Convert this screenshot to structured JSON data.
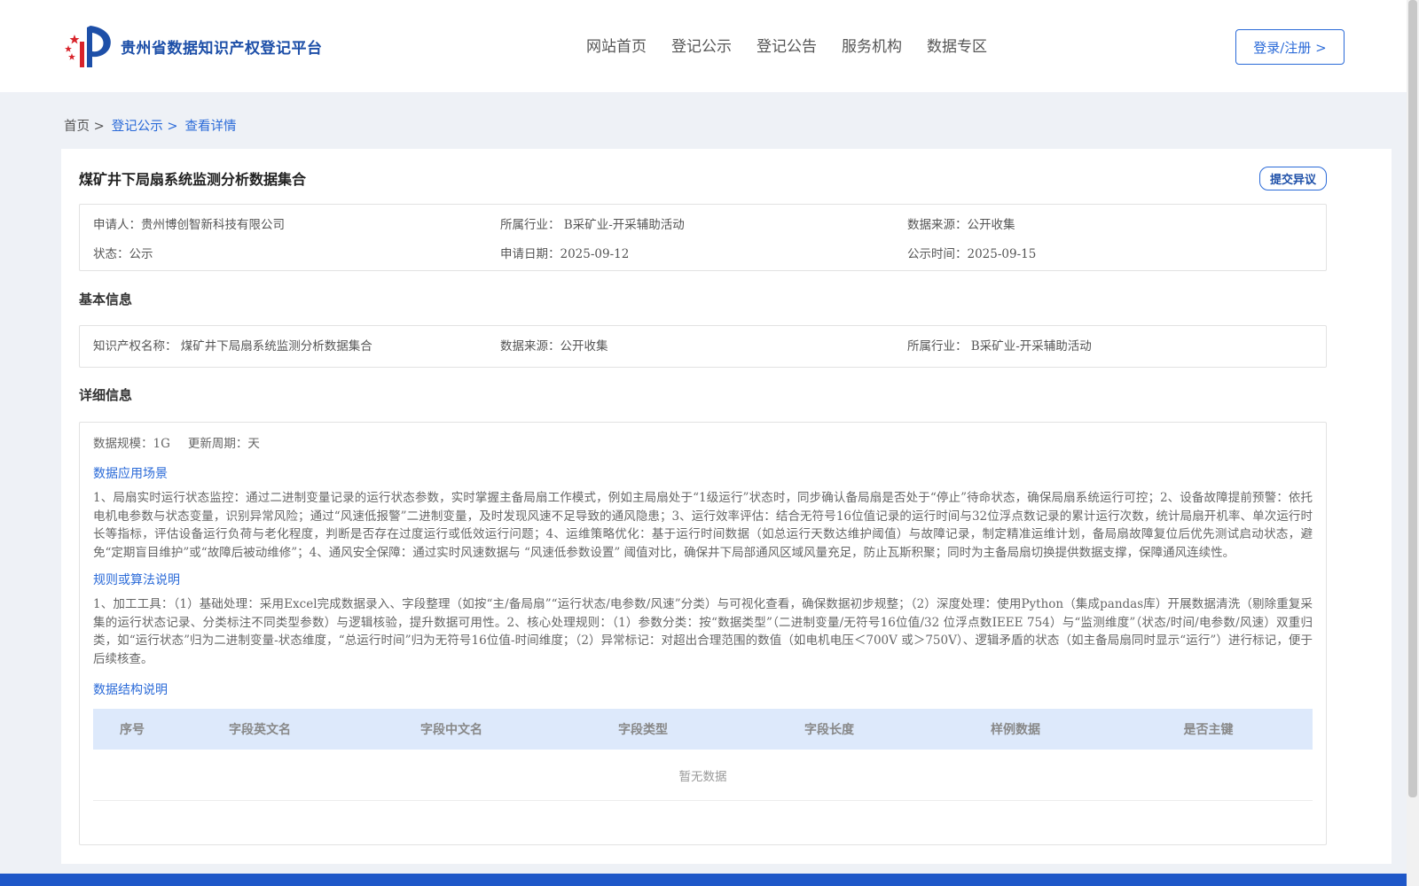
{
  "header": {
    "site_title": "贵州省数据知识产权登记平台",
    "nav": [
      "网站首页",
      "登记公示",
      "登记公告",
      "服务机构",
      "数据专区"
    ],
    "login_label": "登录/注册 >"
  },
  "breadcrumb": {
    "home": "首页 >",
    "list": "登记公示 >",
    "current": "查看详情"
  },
  "record": {
    "title": "煤矿井下局扇系统监测分析数据集合",
    "dispute_label": "提交异议",
    "summary": {
      "applicant": "申请人：贵州博创智新科技有限公司",
      "industry": "所属行业： B采矿业-开采辅助活动",
      "source": "数据来源：公开收集",
      "status": "状态：公示",
      "apply_date": "申请日期：2025-09-12",
      "public_date": "公示时间：2025-09-15"
    }
  },
  "basic": {
    "section_title": "基本信息",
    "ip_name": "知识产权名称： 煤矿井下局扇系统监测分析数据集合",
    "source": "数据来源：公开收集",
    "industry": "所属行业： B采矿业-开采辅助活动"
  },
  "detail": {
    "section_title": "详细信息",
    "scale": "数据规模：1G",
    "cycle": "更新周期：天",
    "scenario_title": "数据应用场景",
    "scenario_text": "1、局扇实时运行状态监控：通过二进制变量记录的运行状态参数，实时掌握主备局扇工作模式，例如主局扇处于“1级运行”状态时，同步确认备局扇是否处于“停止”待命状态，确保局扇系统运行可控；2、设备故障提前预警：依托电机电参数与状态变量，识别异常风险；通过“风速低报警”二进制变量，及时发现风速不足导致的通风隐患；3、运行效率评估：结合无符号16位值记录的运行时间与32位浮点数记录的累计运行次数，统计局扇开机率、单次运行时长等指标，评估设备运行负荷与老化程度，判断是否存在过度运行或低效运行问题；4、运维策略优化：基于运行时间数据（如总运行天数达维护阈值）与故障记录，制定精准运维计划，备局扇故障复位后优先测试启动状态，避免“定期盲目维护”或“故障后被动维修”；4、通风安全保障：通过实时风速数据与 “风速低参数设置” 阈值对比，确保井下局部通风区域风量充足，防止瓦斯积聚；同时为主备局扇切换提供数据支撑，保障通风连续性。",
    "rule_title": "规则或算法说明",
    "rule_text": "1、加工工具：（1）基础处理：采用Excel完成数据录入、字段整理（如按“主/备局扇”“运行状态/电参数/风速”分类）与可视化查看，确保数据初步规整；（2）深度处理：使用Python（集成pandas库）开展数据清洗（剔除重复采集的运行状态记录、分类标注不同类型参数）与逻辑核验，提升数据可用性。2、核心处理规则：（1）参数分类：按“数据类型”（二进制变量/无符号16位值/32 位浮点数IEEE 754）与“监测维度”（状态/时间/电参数/风速）双重归类，如“运行状态”归为二进制变量-状态维度，“总运行时间”归为无符号16位值-时间维度；（2）异常标记：对超出合理范围的数值（如电机电压＜700V 或＞750V）、逻辑矛盾的状态（如主备局扇同时显示“运行”）进行标记，便于后续核查。",
    "structure_title": "数据结构说明",
    "table_headers": [
      "序号",
      "字段英文名",
      "字段中文名",
      "字段类型",
      "字段长度",
      "样例数据",
      "是否主键"
    ],
    "empty_text": "暂无数据"
  },
  "colors": {
    "brand_blue": "#1d4fa8",
    "link_blue": "#2a6ad8",
    "table_header_bg": "#dde9fb",
    "footer_bg": "#1e57c8"
  }
}
